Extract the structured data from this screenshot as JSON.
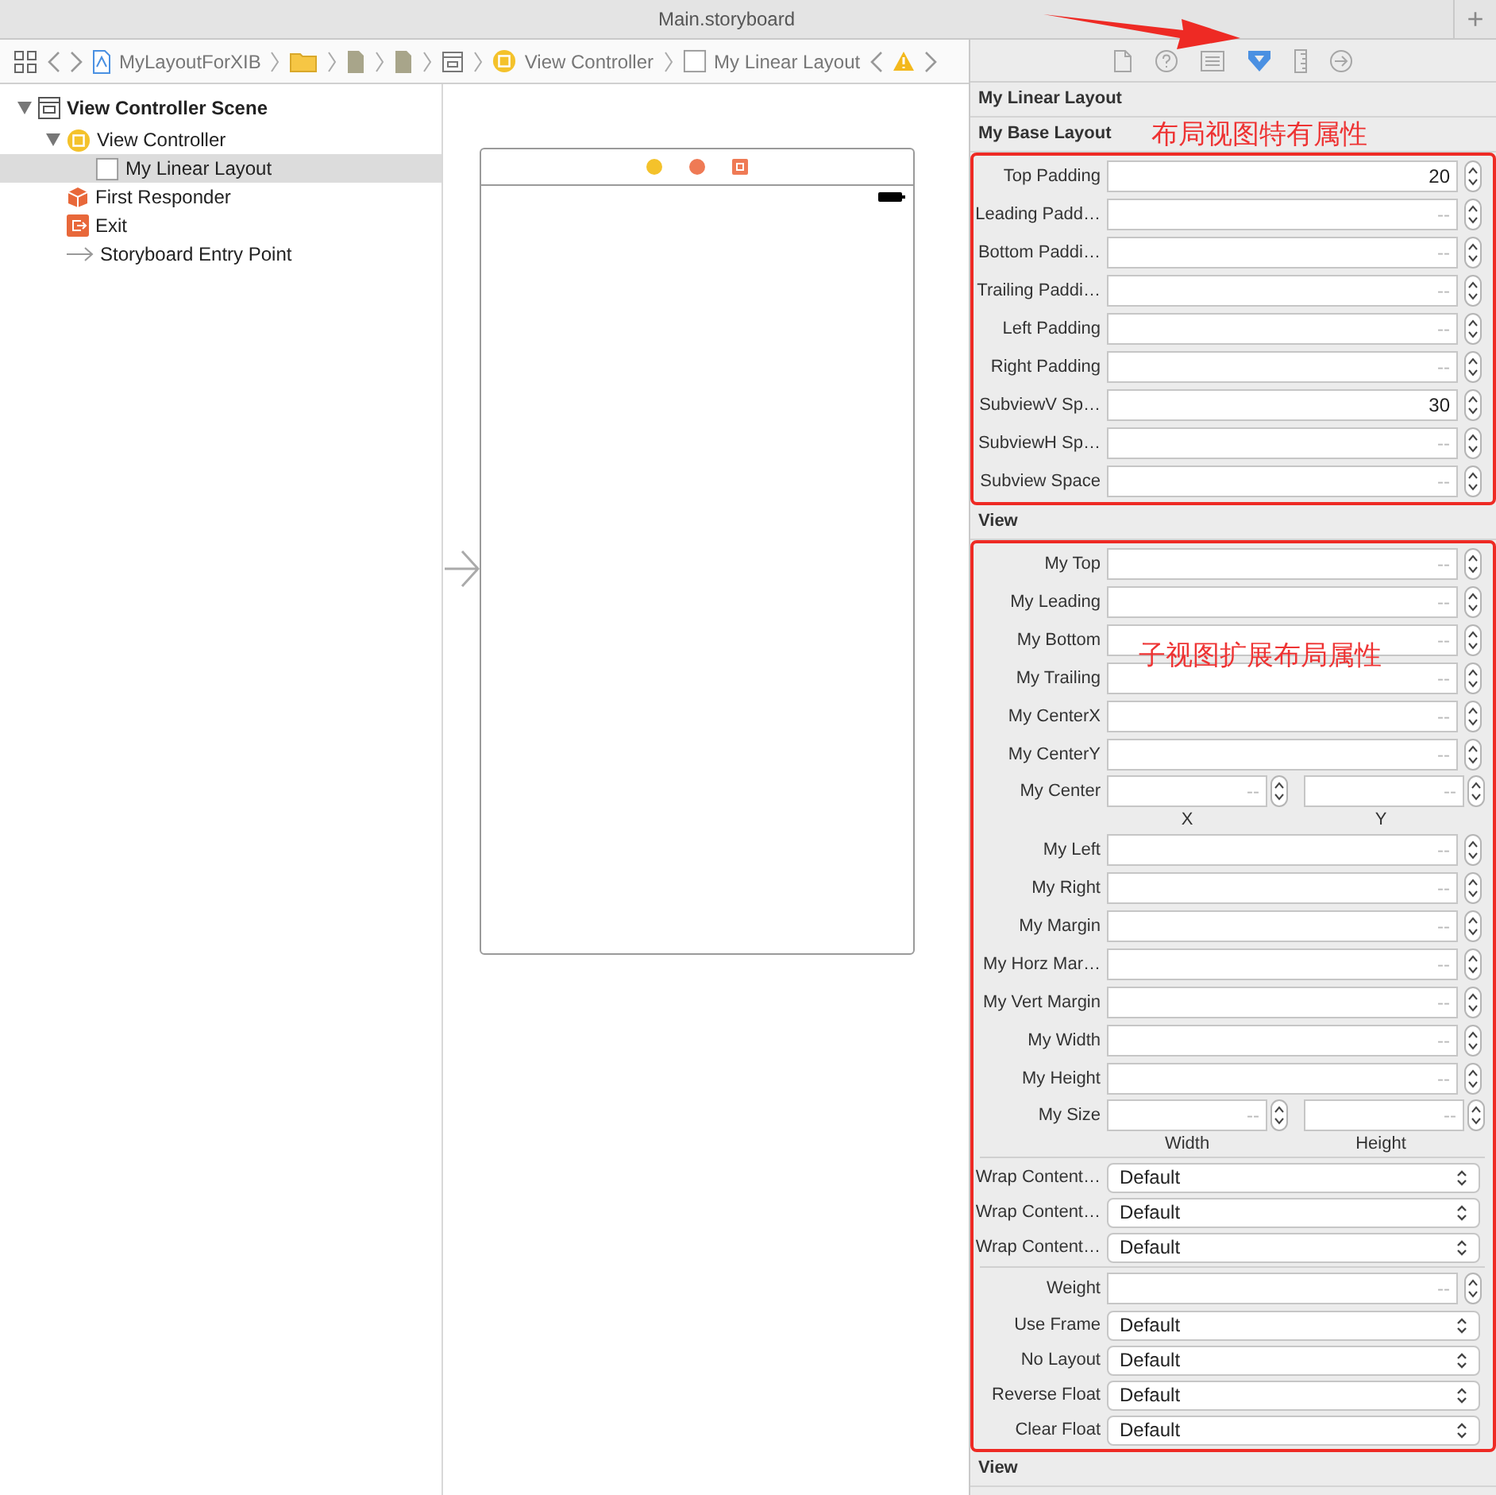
{
  "window": {
    "title": "Main.storyboard",
    "add_tab": "+"
  },
  "jump_bar": [
    {
      "kind": "grid"
    },
    {
      "kind": "back"
    },
    {
      "kind": "forward"
    },
    {
      "kind": "project",
      "label": "MyLayoutForXIB"
    },
    {
      "kind": "sep"
    },
    {
      "kind": "folder"
    },
    {
      "kind": "sep"
    },
    {
      "kind": "file"
    },
    {
      "kind": "sep"
    },
    {
      "kind": "file"
    },
    {
      "kind": "sep"
    },
    {
      "kind": "storyboard"
    },
    {
      "kind": "sep"
    },
    {
      "kind": "view-controller",
      "label": "View Controller"
    },
    {
      "kind": "sep"
    },
    {
      "kind": "view",
      "label": "My Linear Layout"
    },
    {
      "kind": "back"
    },
    {
      "kind": "warning"
    },
    {
      "kind": "forward"
    }
  ],
  "outline": [
    {
      "kind": "scene",
      "label": "View Controller Scene",
      "expanded": true,
      "selected": false,
      "children": [
        {
          "kind": "view-controller",
          "label": "View Controller",
          "expanded": true,
          "selected": false,
          "children": [
            {
              "kind": "view",
              "label": "My Linear Layout",
              "selected": true
            }
          ]
        },
        {
          "kind": "first-responder",
          "label": "First Responder",
          "selected": false
        },
        {
          "kind": "exit",
          "label": "Exit",
          "selected": false
        },
        {
          "kind": "entry-point",
          "label": "Storyboard Entry Point",
          "selected": false
        }
      ]
    }
  ],
  "inspector_tabs": [
    {
      "kind": "file",
      "selected": false
    },
    {
      "kind": "help",
      "selected": false
    },
    {
      "kind": "identity",
      "selected": false
    },
    {
      "kind": "attributes",
      "selected": true
    },
    {
      "kind": "size",
      "selected": false
    },
    {
      "kind": "connections",
      "selected": false
    }
  ],
  "sections": [
    {
      "title": "My Linear Layout"
    },
    {
      "title": "My Base Layout",
      "highlighted": true,
      "header_note": "布局视图特有属性",
      "rows": [
        {
          "kind": "stepper",
          "label": "Top Padding",
          "value": "20"
        },
        {
          "kind": "stepper",
          "label": "Leading Padd…",
          "placeholder": "--"
        },
        {
          "kind": "stepper",
          "label": "Bottom Paddi…",
          "placeholder": "--"
        },
        {
          "kind": "stepper",
          "label": "Trailing Paddi…",
          "placeholder": "--"
        },
        {
          "kind": "stepper",
          "label": "Left Padding",
          "placeholder": "--"
        },
        {
          "kind": "stepper",
          "label": "Right Padding",
          "placeholder": "--"
        },
        {
          "kind": "stepper",
          "label": "SubviewV Sp…",
          "value": "30"
        },
        {
          "kind": "stepper",
          "label": "SubviewH Sp…",
          "placeholder": "--"
        },
        {
          "kind": "stepper",
          "label": "Subview Space",
          "placeholder": "--"
        }
      ]
    },
    {
      "title": "View",
      "highlighted": true,
      "body_note": "子视图扩展布局属性",
      "rows": [
        {
          "kind": "stepper",
          "label": "My Top",
          "placeholder": "--"
        },
        {
          "kind": "stepper",
          "label": "My Leading",
          "placeholder": "--"
        },
        {
          "kind": "stepper",
          "label": "My Bottom",
          "placeholder": "--"
        },
        {
          "kind": "stepper",
          "label": "My Trailing",
          "placeholder": "--"
        },
        {
          "kind": "stepper",
          "label": "My CenterX",
          "placeholder": "--"
        },
        {
          "kind": "stepper",
          "label": "My CenterY",
          "placeholder": "--"
        },
        {
          "kind": "pair",
          "label": "My Center",
          "fields": [
            {
              "placeholder": "--",
              "caption": "X"
            },
            {
              "placeholder": "--",
              "caption": "Y"
            }
          ]
        },
        {
          "kind": "stepper",
          "label": "My Left",
          "placeholder": "--"
        },
        {
          "kind": "stepper",
          "label": "My Right",
          "placeholder": "--"
        },
        {
          "kind": "stepper",
          "label": "My Margin",
          "placeholder": "--"
        },
        {
          "kind": "stepper",
          "label": "My Horz Mar…",
          "placeholder": "--"
        },
        {
          "kind": "stepper",
          "label": "My Vert Margin",
          "placeholder": "--"
        },
        {
          "kind": "stepper",
          "label": "My Width",
          "placeholder": "--"
        },
        {
          "kind": "stepper",
          "label": "My Height",
          "placeholder": "--"
        },
        {
          "kind": "pair",
          "label": "My Size",
          "fields": [
            {
              "placeholder": "--",
              "caption": "Width"
            },
            {
              "placeholder": "--",
              "caption": "Height"
            }
          ]
        },
        {
          "kind": "divider"
        },
        {
          "kind": "popup",
          "label": "Wrap Content…",
          "value": "Default"
        },
        {
          "kind": "popup",
          "label": "Wrap Content…",
          "value": "Default"
        },
        {
          "kind": "popup",
          "label": "Wrap Content…",
          "value": "Default"
        },
        {
          "kind": "divider"
        },
        {
          "kind": "stepper",
          "label": "Weight",
          "placeholder": "--"
        },
        {
          "kind": "popup",
          "label": "Use Frame",
          "value": "Default"
        },
        {
          "kind": "popup",
          "label": "No Layout",
          "value": "Default"
        },
        {
          "kind": "popup",
          "label": "Reverse Float",
          "value": "Default"
        },
        {
          "kind": "popup",
          "label": "Clear Float",
          "value": "Default"
        }
      ]
    },
    {
      "title": "View"
    }
  ]
}
